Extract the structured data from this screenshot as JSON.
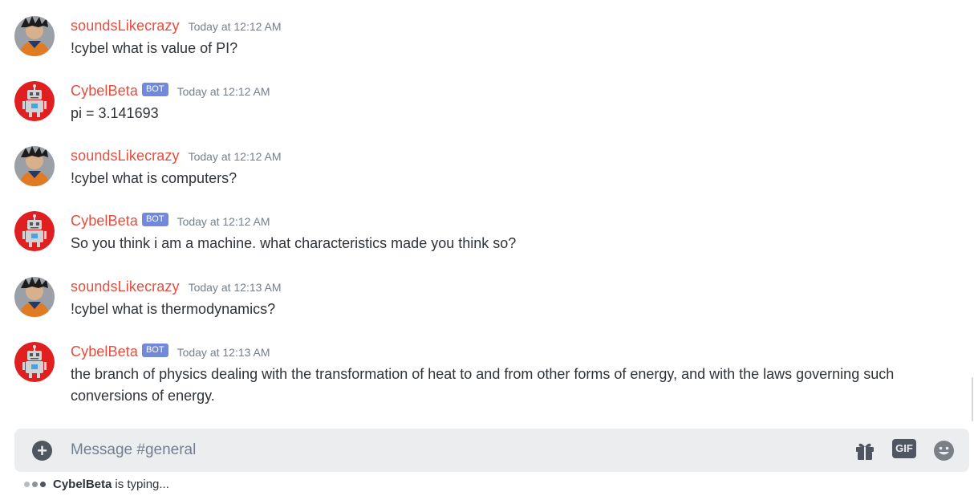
{
  "channel": {
    "name": "general"
  },
  "messages": [
    {
      "author": "soundsLikecrazy",
      "is_bot": false,
      "timestamp": "Today at 12:12 AM",
      "text": "!cybel what is value of PI?",
      "avatar_icon": "user-avatar-icon"
    },
    {
      "author": "CybelBeta",
      "is_bot": true,
      "bot_tag": "BOT",
      "timestamp": "Today at 12:12 AM",
      "text": "pi = 3.141693",
      "avatar_icon": "robot-avatar-icon"
    },
    {
      "author": "soundsLikecrazy",
      "is_bot": false,
      "timestamp": "Today at 12:12 AM",
      "text": "!cybel what is computers?",
      "avatar_icon": "user-avatar-icon"
    },
    {
      "author": "CybelBeta",
      "is_bot": true,
      "bot_tag": "BOT",
      "timestamp": "Today at 12:12 AM",
      "text": "So you think i am a machine. what characteristics made you think so?",
      "avatar_icon": "robot-avatar-icon"
    },
    {
      "author": "soundsLikecrazy",
      "is_bot": false,
      "timestamp": "Today at 12:13 AM",
      "text": "!cybel what is thermodynamics?",
      "avatar_icon": "user-avatar-icon"
    },
    {
      "author": "CybelBeta",
      "is_bot": true,
      "bot_tag": "BOT",
      "timestamp": "Today at 12:13 AM",
      "text": "the branch of physics dealing with the transformation of heat to and from other forms of energy, and with the laws governing such conversions of energy.",
      "avatar_icon": "robot-avatar-icon"
    }
  ],
  "composer": {
    "placeholder": "Message #general",
    "value": "",
    "gif_label": "GIF",
    "icons": [
      "plus-icon",
      "gift-icon",
      "gif-icon",
      "emoji-icon"
    ]
  },
  "typing": {
    "user": "CybelBeta",
    "suffix": "is typing..."
  },
  "colors": {
    "username": "#e74c3c",
    "bot_tag": "#7289da",
    "timestamp": "#747f8d",
    "text": "#2e3338",
    "composer_bg": "#ebedef",
    "icon": "#4f5660"
  }
}
